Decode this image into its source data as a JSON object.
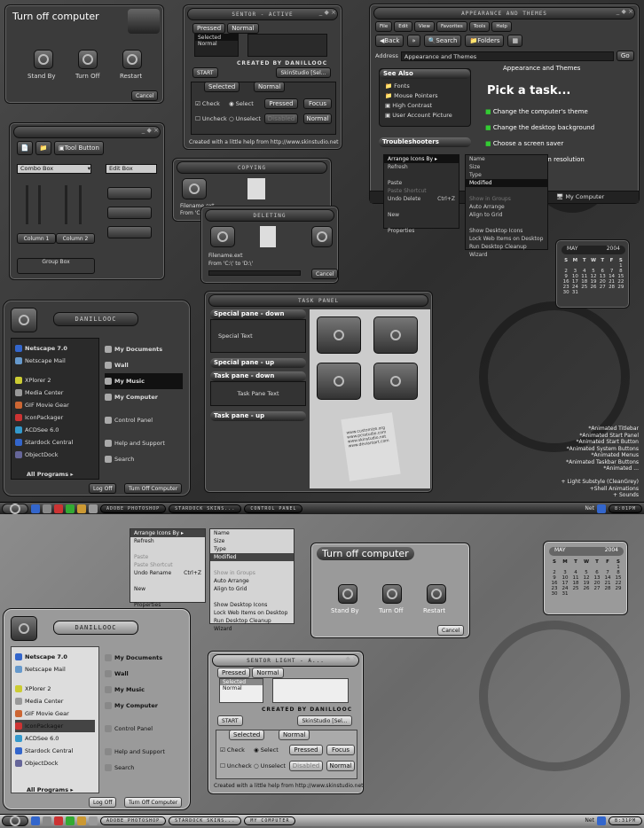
{
  "shutdown": {
    "title": "Turn off computer",
    "standby": "Stand By",
    "turnoff": "Turn Off",
    "restart": "Restart",
    "cancel": "Cancel"
  },
  "skin": {
    "title": "SENTOR - ACTIVE",
    "tab_pressed": "Pressed",
    "tab_normal": "Normal",
    "list_selected": "Selected",
    "list_normal": "Normal",
    "created_by": "CREATED BY DANILLOOC",
    "start": "START",
    "skinstudio": "SkinStudio [Sel...",
    "tab_selected": "Selected",
    "tab_normal2": "Normal",
    "check": "Check",
    "select": "Select",
    "uncheck": "Uncheck",
    "unselect": "Unselect",
    "pressed": "Pressed",
    "focus": "Focus",
    "disabled": "Disabled",
    "normal": "Normal",
    "footer": "Created with a little help from http://www.skinstudio.net"
  },
  "skin2": {
    "title": "SENTOR LIGHT - A...",
    "skinstudio": "SkinStudio [Sel..."
  },
  "explorer": {
    "title": "APPEARANCE AND THEMES",
    "menu": [
      "File",
      "Edit",
      "View",
      "Favorites",
      "Tools",
      "Help"
    ],
    "back": "Back",
    "search": "Search",
    "folders": "Folders",
    "address_label": "Address",
    "address": "Appearance and Themes",
    "go": "Go",
    "see_also": "See Also",
    "see_also_items": [
      "Fonts",
      "Mouse Pointers",
      "High Contrast",
      "User Account Picture"
    ],
    "troubleshooters": "Troubleshooters",
    "header": "Appearance and Themes",
    "pick": "Pick a task...",
    "tasks": [
      "Change the computer's theme",
      "Change the desktop background",
      "Choose a screen saver",
      "Change the screen resolution"
    ],
    "status": "My Computer"
  },
  "ctx": {
    "items": [
      "Arrange Icons By",
      "Refresh",
      "",
      "Paste",
      "Paste Shortcut",
      "Undo Delete",
      "",
      "New",
      "",
      "Properties"
    ],
    "shortcut": "Ctrl+Z",
    "sub": [
      "Name",
      "Size",
      "Type",
      "Modified",
      "",
      "Show in Groups",
      "Auto Arrange",
      "Align to Grid",
      "",
      "Show Desktop Icons",
      "Lock Web Items on Desktop",
      "Run Desktop Cleanup Wizard"
    ]
  },
  "ctx2": {
    "items": [
      "Arrange Icons By",
      "Refresh",
      "",
      "Paste",
      "Paste Shortcut",
      "Undo Rename",
      "",
      "New",
      "",
      "Properties"
    ],
    "shortcut": "Ctrl+Z"
  },
  "toolbar_win": {
    "tool_button": "Tool Button",
    "combo": "Combo Box",
    "edit": "Edit Box",
    "col1": "Column 1",
    "col2": "Column 2",
    "group": "Group Box"
  },
  "copying": {
    "title": "COPYING",
    "file": "Filename.ext",
    "from": "From 'C:\\'"
  },
  "deleting": {
    "title": "DELETING",
    "file": "Filename.ext",
    "from": "From 'C:\\' to 'D:\\'",
    "cancel": "Cancel"
  },
  "taskpanel": {
    "title": "TASK PANEL",
    "special_down": "Special pane - down",
    "special_text": "Special Text",
    "special_up": "Special pane - up",
    "task_down": "Task pane - down",
    "task_text": "Task Pane Text",
    "task_up": "Task pane - up",
    "wc1": "www.customize.org",
    "wc2": "www.pcsstudio.com",
    "wc3": "www.skinstudio.net",
    "wc4": "www.deviantart.com"
  },
  "calendar": {
    "month": "MAY",
    "year": "2004",
    "days": [
      "S",
      "M",
      "T",
      "W",
      "T",
      "F",
      "S"
    ],
    "dates": [
      "",
      "",
      "",
      "",
      "",
      "",
      "1",
      "2",
      "3",
      "4",
      "5",
      "6",
      "7",
      "8",
      "9",
      "10",
      "11",
      "12",
      "13",
      "14",
      "15",
      "16",
      "17",
      "18",
      "19",
      "20",
      "21",
      "22",
      "23",
      "24",
      "25",
      "26",
      "27",
      "28",
      "29",
      "30",
      "31",
      "",
      "",
      "",
      ""
    ]
  },
  "startmenu": {
    "user": "DANILLOOC",
    "pinned": [
      "Netscape 7.0",
      "Netscape Mail"
    ],
    "recent": [
      "XPlorer 2",
      "Media Center",
      "GIF Movie Gear",
      "IconPackager",
      "ACDSee 6.0",
      "Stardock Central",
      "ObjectDock"
    ],
    "right": [
      "My Documents",
      "Wall",
      "My Music",
      "My Computer",
      "Control Panel",
      "Help and Support",
      "Search"
    ],
    "all": "All Programs",
    "logoff": "Log Off",
    "turnoff": "Turn Off Computer"
  },
  "features": [
    "*Animated Titlebar",
    "*Animated Start Panel",
    "*Animated Start Button",
    "*Animated System Buttons",
    "*Animated Menus",
    "*Animated Taskbar Buttons",
    "*Animated ...",
    "",
    "+ Light Substyle (CleanGrey)",
    "+Shell Animations",
    "+ Sounds"
  ],
  "taskbar1": {
    "items": [
      "ADOBE PHOTOSHOP",
      "STARDOCK SKINS...",
      "CONTROL PANEL"
    ],
    "net": "Net",
    "time": "8:01PM"
  },
  "taskbar2": {
    "items": [
      "ADOBE PHOTOSHOP",
      "STARDOCK SKINS...",
      "MY COMPUTER"
    ],
    "net": "Net",
    "time": "8:31PM"
  }
}
